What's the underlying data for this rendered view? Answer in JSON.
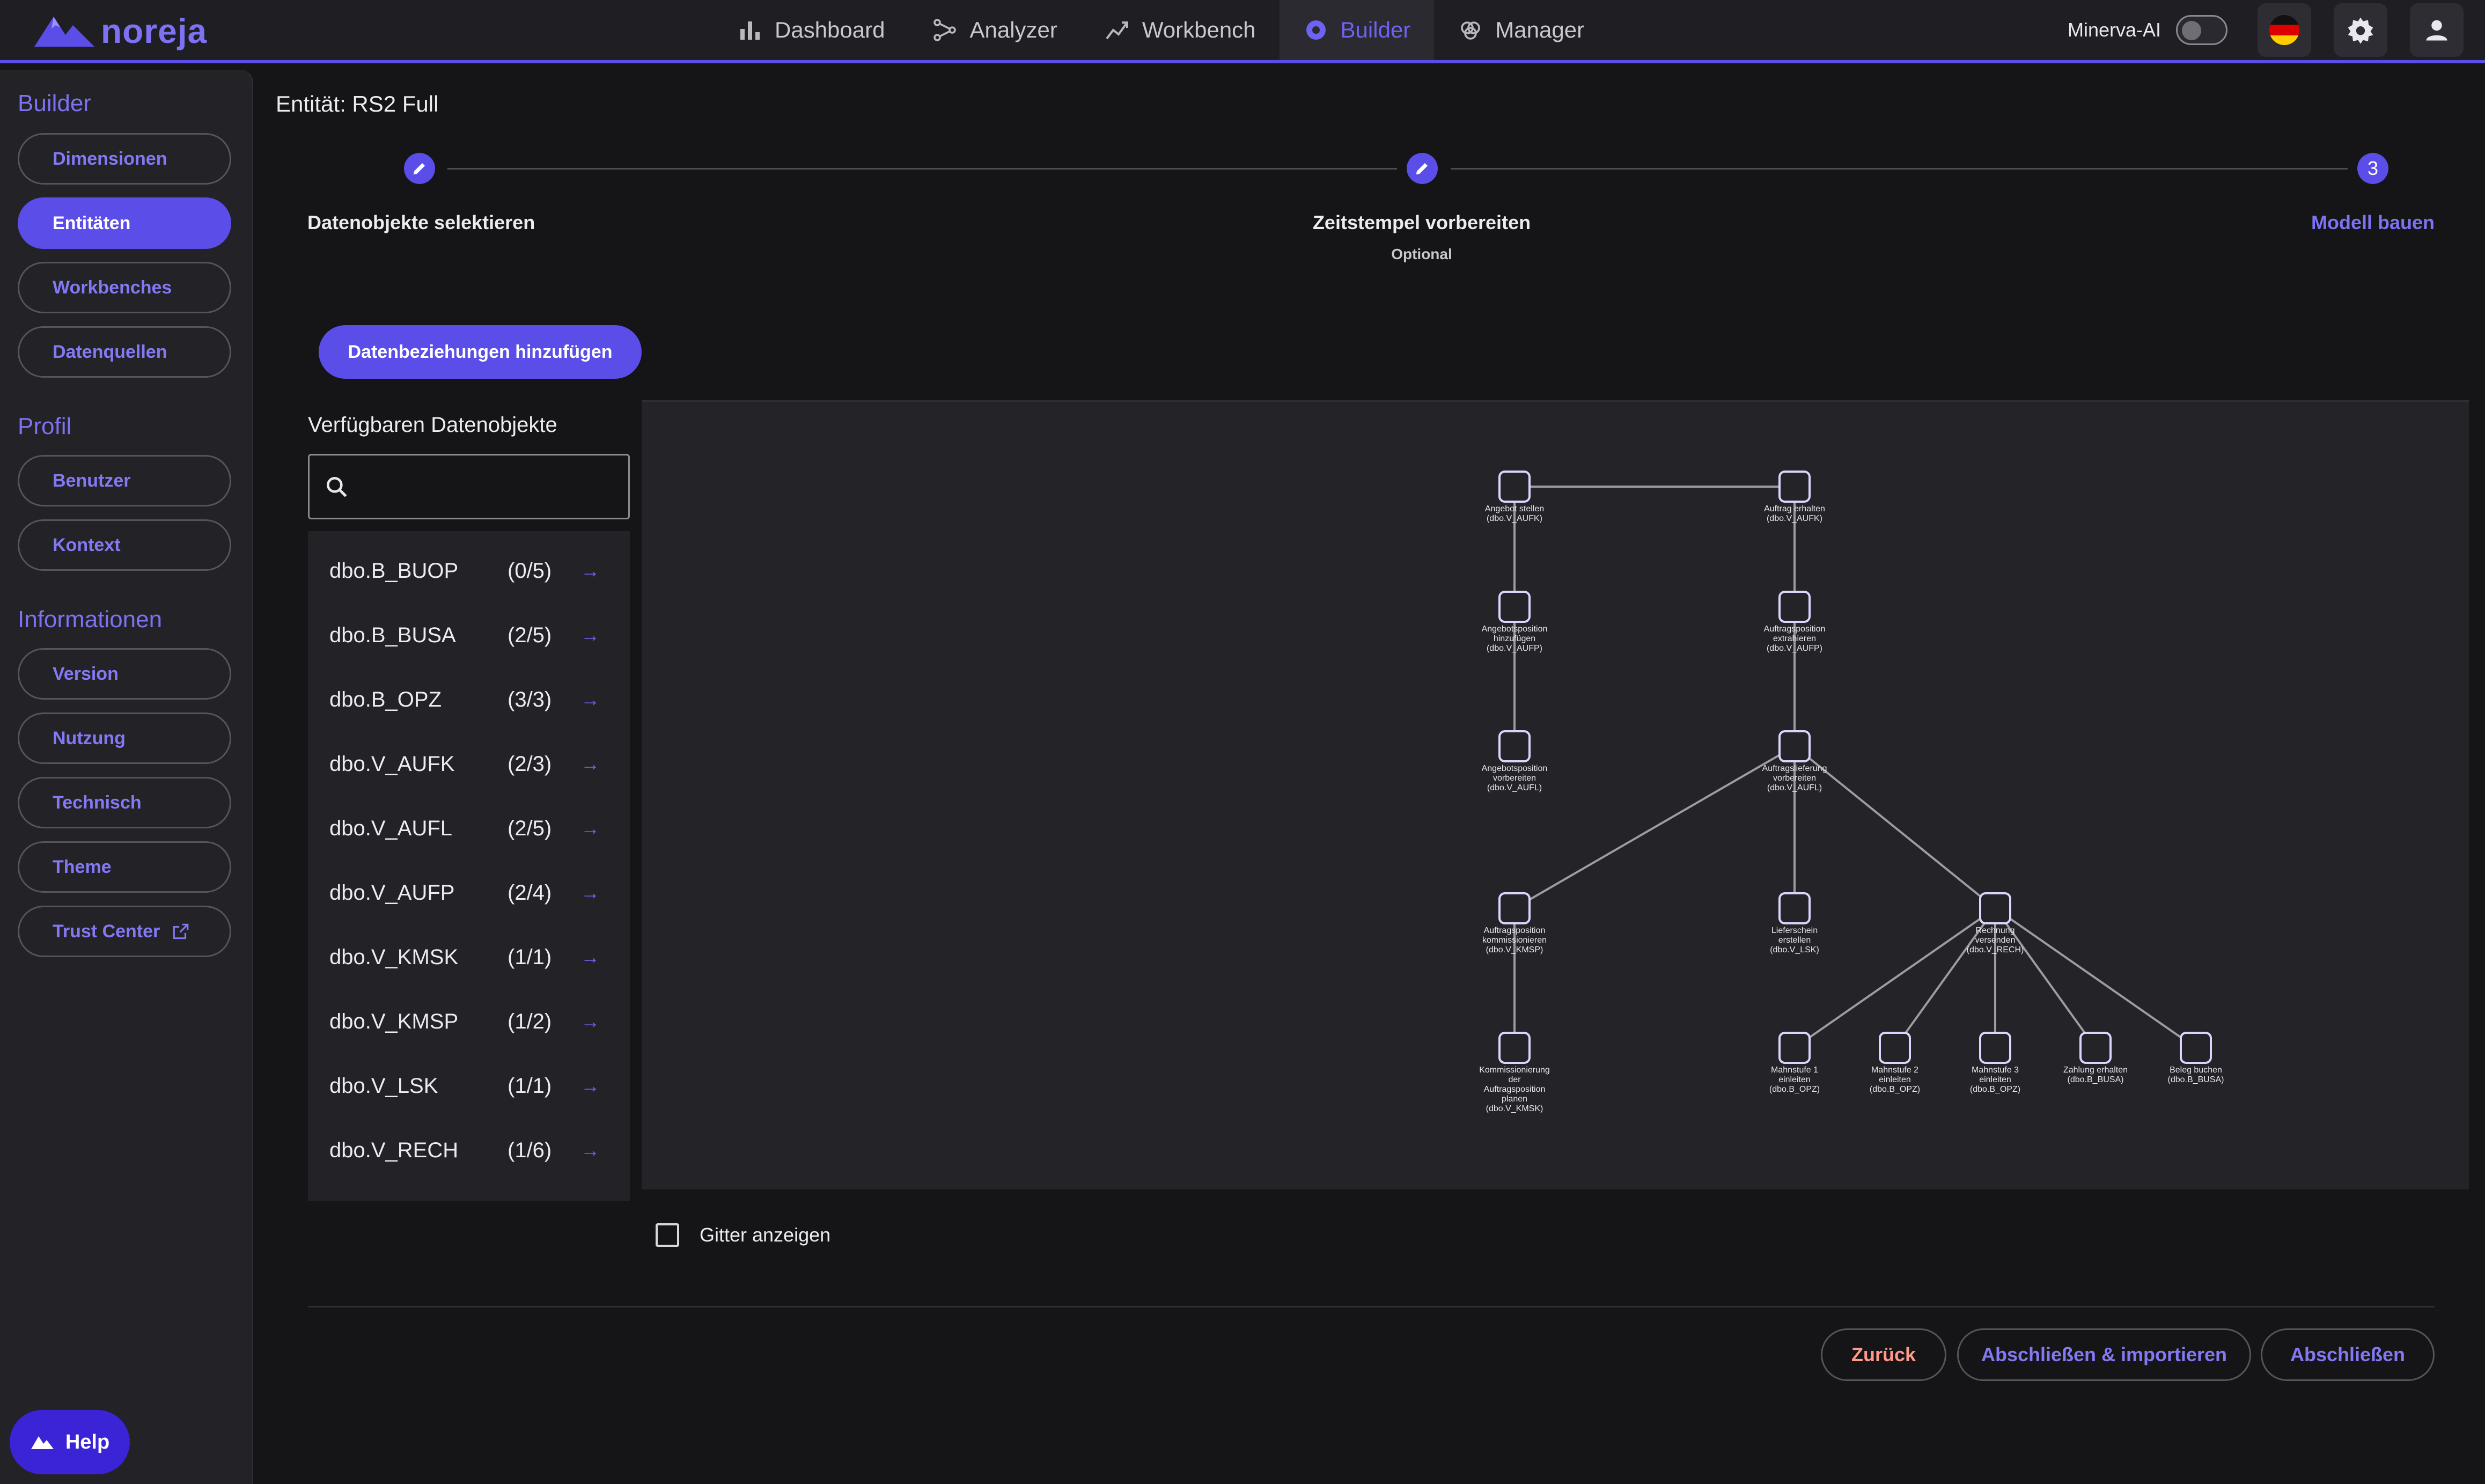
{
  "app": {
    "logo_text": "noreja"
  },
  "nav": [
    {
      "label": "Dashboard",
      "icon": "bar-chart-icon"
    },
    {
      "label": "Analyzer",
      "icon": "process-analyzer-icon"
    },
    {
      "label": "Workbench",
      "icon": "trend-chart-icon"
    },
    {
      "label": "Builder",
      "icon": "builder-gear-icon",
      "active": true
    },
    {
      "label": "Manager",
      "icon": "brain-icon"
    }
  ],
  "topright": {
    "minerva_label": "Minerva-AI",
    "minerva_enabled": false,
    "language_flag": "german-flag-icon"
  },
  "sidebar": {
    "sections": [
      {
        "heading": "Builder",
        "items": [
          "Dimensionen",
          "Entitäten",
          "Workbenches",
          "Datenquellen"
        ],
        "active": "Entitäten"
      },
      {
        "heading": "Profil",
        "items": [
          "Benutzer",
          "Kontext"
        ]
      },
      {
        "heading": "Informationen",
        "items": [
          "Version",
          "Nutzung",
          "Technisch",
          "Theme",
          "Trust Center"
        ]
      }
    ],
    "help_label": "Help"
  },
  "main": {
    "entity_title": "Entität: RS2 Full",
    "stepper": [
      {
        "label": "Datenobjekte selektieren",
        "state": "done",
        "icon": "pencil-icon"
      },
      {
        "label": "Zeitstempel vorbereiten",
        "sublabel": "Optional",
        "state": "done",
        "icon": "pencil-icon"
      },
      {
        "label": "Modell bauen",
        "state": "active",
        "number": "3"
      }
    ],
    "add_relations_button": "Datenbeziehungen hinzufügen",
    "available_heading": "Verfügbaren Datenobjekte",
    "search": {
      "value": "",
      "placeholder": ""
    },
    "objects": [
      {
        "name": "dbo.B_BUOP",
        "count": "(0/5)"
      },
      {
        "name": "dbo.B_BUSA",
        "count": "(2/5)"
      },
      {
        "name": "dbo.B_OPZ",
        "count": "(3/3)"
      },
      {
        "name": "dbo.V_AUFK",
        "count": "(2/3)"
      },
      {
        "name": "dbo.V_AUFL",
        "count": "(2/5)"
      },
      {
        "name": "dbo.V_AUFP",
        "count": "(2/4)"
      },
      {
        "name": "dbo.V_KMSK",
        "count": "(1/1)"
      },
      {
        "name": "dbo.V_KMSP",
        "count": "(1/2)"
      },
      {
        "name": "dbo.V_LSK",
        "count": "(1/1)"
      },
      {
        "name": "dbo.V_RECH",
        "count": "(1/6)"
      }
    ],
    "graph_nodes": [
      {
        "lines": [
          "Angebot stellen",
          "(dbo.V_AUFK)"
        ]
      },
      {
        "lines": [
          "Auftrag erhalten",
          "(dbo.V_AUFK)"
        ]
      },
      {
        "lines": [
          "Angebotsposition",
          "hinzufügen",
          "(dbo.V_AUFP)"
        ]
      },
      {
        "lines": [
          "Auftragsposition",
          "extrahieren",
          "(dbo.V_AUFP)"
        ]
      },
      {
        "lines": [
          "Angebotsposition",
          "vorbereiten",
          "(dbo.V_AUFL)"
        ]
      },
      {
        "lines": [
          "Auftragslieferung",
          "vorbereiten",
          "(dbo.V_AUFL)"
        ]
      },
      {
        "lines": [
          "Auftragsposition",
          "kommissionieren",
          "(dbo.V_KMSP)"
        ]
      },
      {
        "lines": [
          "Lieferschein",
          "erstellen",
          "(dbo.V_LSK)"
        ]
      },
      {
        "lines": [
          "Rechnung",
          "versenden",
          "(dbo.V_RECH)"
        ]
      },
      {
        "lines": [
          "Kommissionierung",
          "der",
          "Auftragsposition",
          "planen",
          "(dbo.V_KMSK)"
        ]
      },
      {
        "lines": [
          "Mahnstufe 1",
          "einleiten",
          "(dbo.B_OPZ)"
        ]
      },
      {
        "lines": [
          "Mahnstufe 2",
          "einleiten",
          "(dbo.B_OPZ)"
        ]
      },
      {
        "lines": [
          "Mahnstufe 3",
          "einleiten",
          "(dbo.B_OPZ)"
        ]
      },
      {
        "lines": [
          "Zahlung erhalten",
          "(dbo.B_BUSA)"
        ]
      },
      {
        "lines": [
          "Beleg buchen",
          "(dbo.B_BUSA)"
        ]
      }
    ],
    "graph_edges": [
      [
        0,
        1
      ],
      [
        0,
        2
      ],
      [
        2,
        4
      ],
      [
        1,
        3
      ],
      [
        3,
        5
      ],
      [
        5,
        6
      ],
      [
        5,
        7
      ],
      [
        5,
        8
      ],
      [
        6,
        9
      ],
      [
        8,
        10
      ],
      [
        8,
        11
      ],
      [
        8,
        12
      ],
      [
        8,
        13
      ],
      [
        8,
        14
      ]
    ],
    "grid_checkbox": {
      "label": "Gitter anzeigen",
      "checked": false
    },
    "buttons": {
      "back": "Zurück",
      "finish_import": "Abschließen & importieren",
      "finish": "Abschließen"
    }
  },
  "colors": {
    "accent": "#5b4de8",
    "accent_text": "#7d72f3",
    "background": "#151417",
    "panel": "#232227",
    "back_button": "#ff9a8a"
  }
}
